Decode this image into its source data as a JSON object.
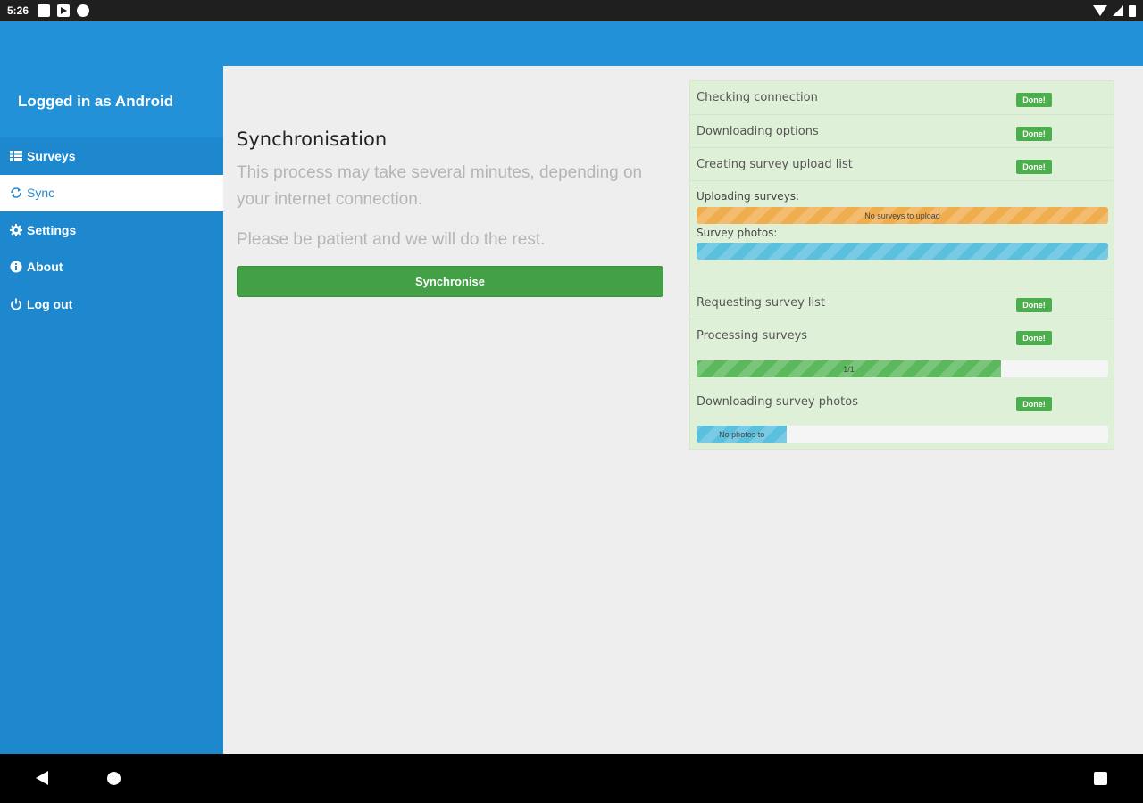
{
  "status_bar": {
    "time": "5:26",
    "icons": [
      "square-notification-icon",
      "play-notification-icon",
      "circle-notification-icon",
      "wifi-icon",
      "signal-icon",
      "battery-icon"
    ]
  },
  "sidebar": {
    "logged_in_text": "Logged in as Android",
    "items": [
      {
        "label": "Surveys",
        "icon": "table-icon",
        "active": false
      },
      {
        "label": "Sync",
        "icon": "refresh-icon",
        "active": true
      },
      {
        "label": "Settings",
        "icon": "gear-icon",
        "active": false
      },
      {
        "label": "About",
        "icon": "info-icon",
        "active": false
      },
      {
        "label": "Log out",
        "icon": "power-icon",
        "active": false
      }
    ]
  },
  "main": {
    "title": "Synchronisation",
    "description": "This process may take several minutes, depending on your internet connection.",
    "patience_text": "Please be patient and we will do the rest.",
    "sync_button": "Synchronise"
  },
  "progress": {
    "steps_top": [
      {
        "label": "Checking connection",
        "status": "Done!"
      },
      {
        "label": "Downloading options",
        "status": "Done!"
      },
      {
        "label": "Creating survey upload list",
        "status": "Done!"
      }
    ],
    "uploading_label": "Uploading surveys:",
    "uploading_bar": {
      "text": "No surveys to upload",
      "progress": 1.0,
      "color": "#f0ad4e"
    },
    "photos_label": "Survey photos:",
    "photos_bar": {
      "text": "",
      "progress": 1.0,
      "color": "#5bc0de"
    },
    "steps_bottom": [
      {
        "label": "Requesting survey list",
        "status": "Done!"
      },
      {
        "label": "Processing surveys",
        "status": "Done!"
      }
    ],
    "processing_bar": {
      "text": "1/1",
      "progress": 0.74,
      "color": "#5cb85c"
    },
    "downloading_photos": {
      "label": "Downloading survey photos",
      "status": "Done!"
    },
    "photos_download_bar": {
      "text": "No photos to",
      "progress": 0.22,
      "color": "#5bc0de"
    }
  },
  "colors": {
    "primary_blue": "#2391d8",
    "sidebar_blue": "#1e88cf",
    "success_green": "#43a047",
    "panel_green": "#dff0d8"
  }
}
